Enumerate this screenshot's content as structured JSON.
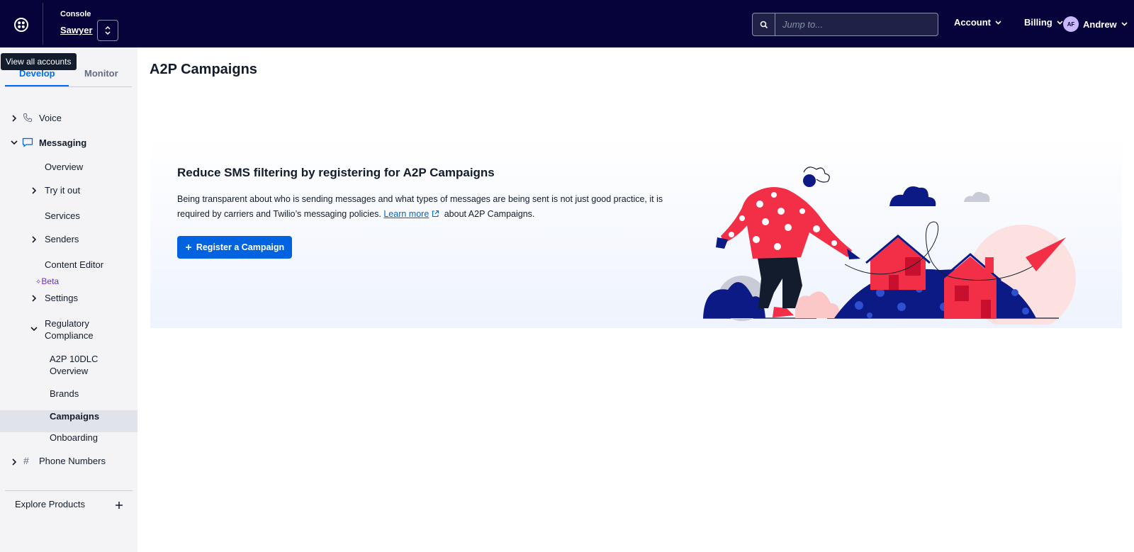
{
  "header": {
    "console_label": "Console",
    "account_name": "Sawyer",
    "search_placeholder": "Jump to...",
    "account_menu": "Account",
    "billing_menu": "Billing",
    "user_initials": "AF",
    "user_name": "Andrew",
    "bg_color": "#06033a"
  },
  "tooltip": {
    "text": "View all accounts"
  },
  "sidebar": {
    "tabs": [
      {
        "label": "Develop",
        "active": true
      },
      {
        "label": "Monitor",
        "active": false
      }
    ],
    "items": [
      {
        "label": "Voice",
        "chevron": "›"
      },
      {
        "label": "Messaging",
        "chevron": "⌄"
      },
      {
        "label": "Overview"
      },
      {
        "label": "Try it out",
        "chevron": "›"
      },
      {
        "label": "Services"
      },
      {
        "label": "Senders",
        "chevron": "›"
      },
      {
        "label": "Content Editor",
        "badge": "Beta"
      },
      {
        "label": "Settings",
        "chevron": "›"
      },
      {
        "label": "Regulatory Compliance",
        "chevron": "⌄"
      },
      {
        "label": "A2P 10DLC Overview"
      },
      {
        "label": "Brands"
      },
      {
        "label": "Campaigns",
        "active": true
      },
      {
        "label": "Onboarding"
      },
      {
        "label": "Phone Numbers",
        "chevron": "›"
      }
    ],
    "explore_products": "Explore Products"
  },
  "main": {
    "page_title": "A2P Campaigns",
    "banner": {
      "title": "Reduce SMS filtering by registering for A2P Campaigns",
      "text_before_link": "Being transparent about who is sending messages and what types of messages are being sent is not just good practice, it is required by carriers and Twilio’s messaging policies.",
      "link_text": "Learn more",
      "text_after_link": "about A2P Campaigns.",
      "button_label": "Register a Campaign",
      "accent_color": "#0263e0"
    }
  }
}
